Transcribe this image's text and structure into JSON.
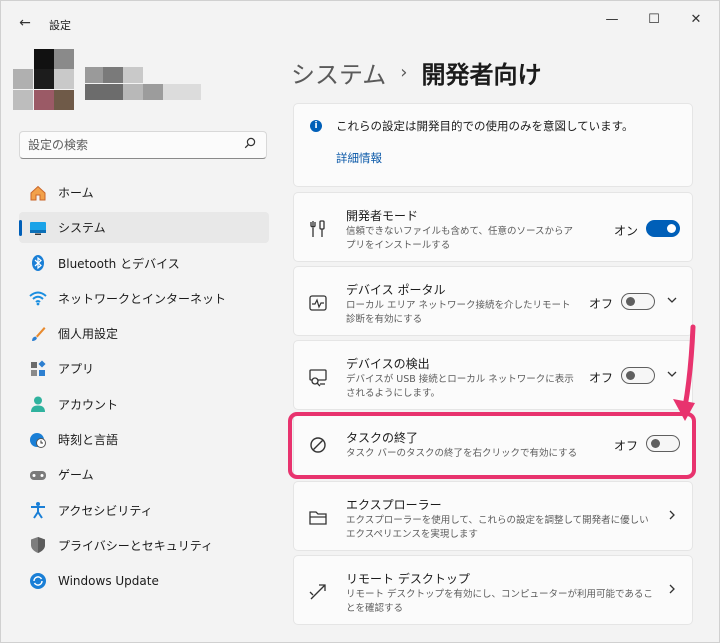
{
  "window": {
    "title": "設定",
    "back_glyph": "←",
    "controls": {
      "minimize": "—",
      "maximize": "☐",
      "close": "✕"
    }
  },
  "search": {
    "placeholder": "設定の検索",
    "icon": "search-icon"
  },
  "sidebar": {
    "items": [
      {
        "label": "ホーム",
        "icon": "home-icon",
        "active": false
      },
      {
        "label": "システム",
        "icon": "monitor-icon",
        "active": true
      },
      {
        "label": "Bluetooth とデバイス",
        "icon": "bluetooth-icon",
        "active": false
      },
      {
        "label": "ネットワークとインターネット",
        "icon": "wifi-icon",
        "active": false
      },
      {
        "label": "個人用設定",
        "icon": "brush-icon",
        "active": false
      },
      {
        "label": "アプリ",
        "icon": "apps-icon",
        "active": false
      },
      {
        "label": "アカウント",
        "icon": "person-icon",
        "active": false
      },
      {
        "label": "時刻と言語",
        "icon": "clock-globe-icon",
        "active": false
      },
      {
        "label": "ゲーム",
        "icon": "gamepad-icon",
        "active": false
      },
      {
        "label": "アクセシビリティ",
        "icon": "accessibility-icon",
        "active": false
      },
      {
        "label": "プライバシーとセキュリティ",
        "icon": "shield-icon",
        "active": false
      },
      {
        "label": "Windows Update",
        "icon": "update-icon",
        "active": false
      }
    ]
  },
  "header": {
    "parent": "システム",
    "separator": "›",
    "current": "開発者向け"
  },
  "info_card": {
    "text": "これらの設定は開発目的での使用のみを意図しています。",
    "link": "詳細情報",
    "icon_glyph": "i"
  },
  "settings": [
    {
      "title": "開発者モード",
      "description": "信頼できないファイルも含めて、任意のソースからアプリをインストールする",
      "toggle_label": "オン",
      "toggle_on": true,
      "has_chevron": false,
      "icon": "developer-tools-icon"
    },
    {
      "title": "デバイス ポータル",
      "description": "ローカル エリア ネットワーク接続を介したリモート診断を有効にする",
      "toggle_label": "オフ",
      "toggle_on": false,
      "has_chevron": true,
      "icon": "pulse-icon"
    },
    {
      "title": "デバイスの検出",
      "description": "デバイスが USB 接続とローカル ネットワークに表示されるようにします。",
      "toggle_label": "オフ",
      "toggle_on": false,
      "has_chevron": true,
      "icon": "device-discovery-icon"
    },
    {
      "title": "タスクの終了",
      "description": "タスク バーのタスクの終了を右クリックで有効にする",
      "toggle_label": "オフ",
      "toggle_on": false,
      "has_chevron": false,
      "icon": "block-icon"
    },
    {
      "title": "エクスプローラー",
      "description": "エクスプローラーを使用して、これらの設定を調整して開発者に優しいエクスペリエンスを実現します",
      "has_chevron": true,
      "icon": "folder-icon"
    },
    {
      "title": "リモート デスクトップ",
      "description": "リモート デスクトップを有効にし、コンピューターが利用可能であることを確認する",
      "has_chevron": true,
      "icon": "remote-desktop-icon"
    }
  ],
  "colors": {
    "accent": "#005fb8",
    "highlight": "#e8336e",
    "background": "#f3f3f3",
    "card": "#fbfbfb"
  }
}
